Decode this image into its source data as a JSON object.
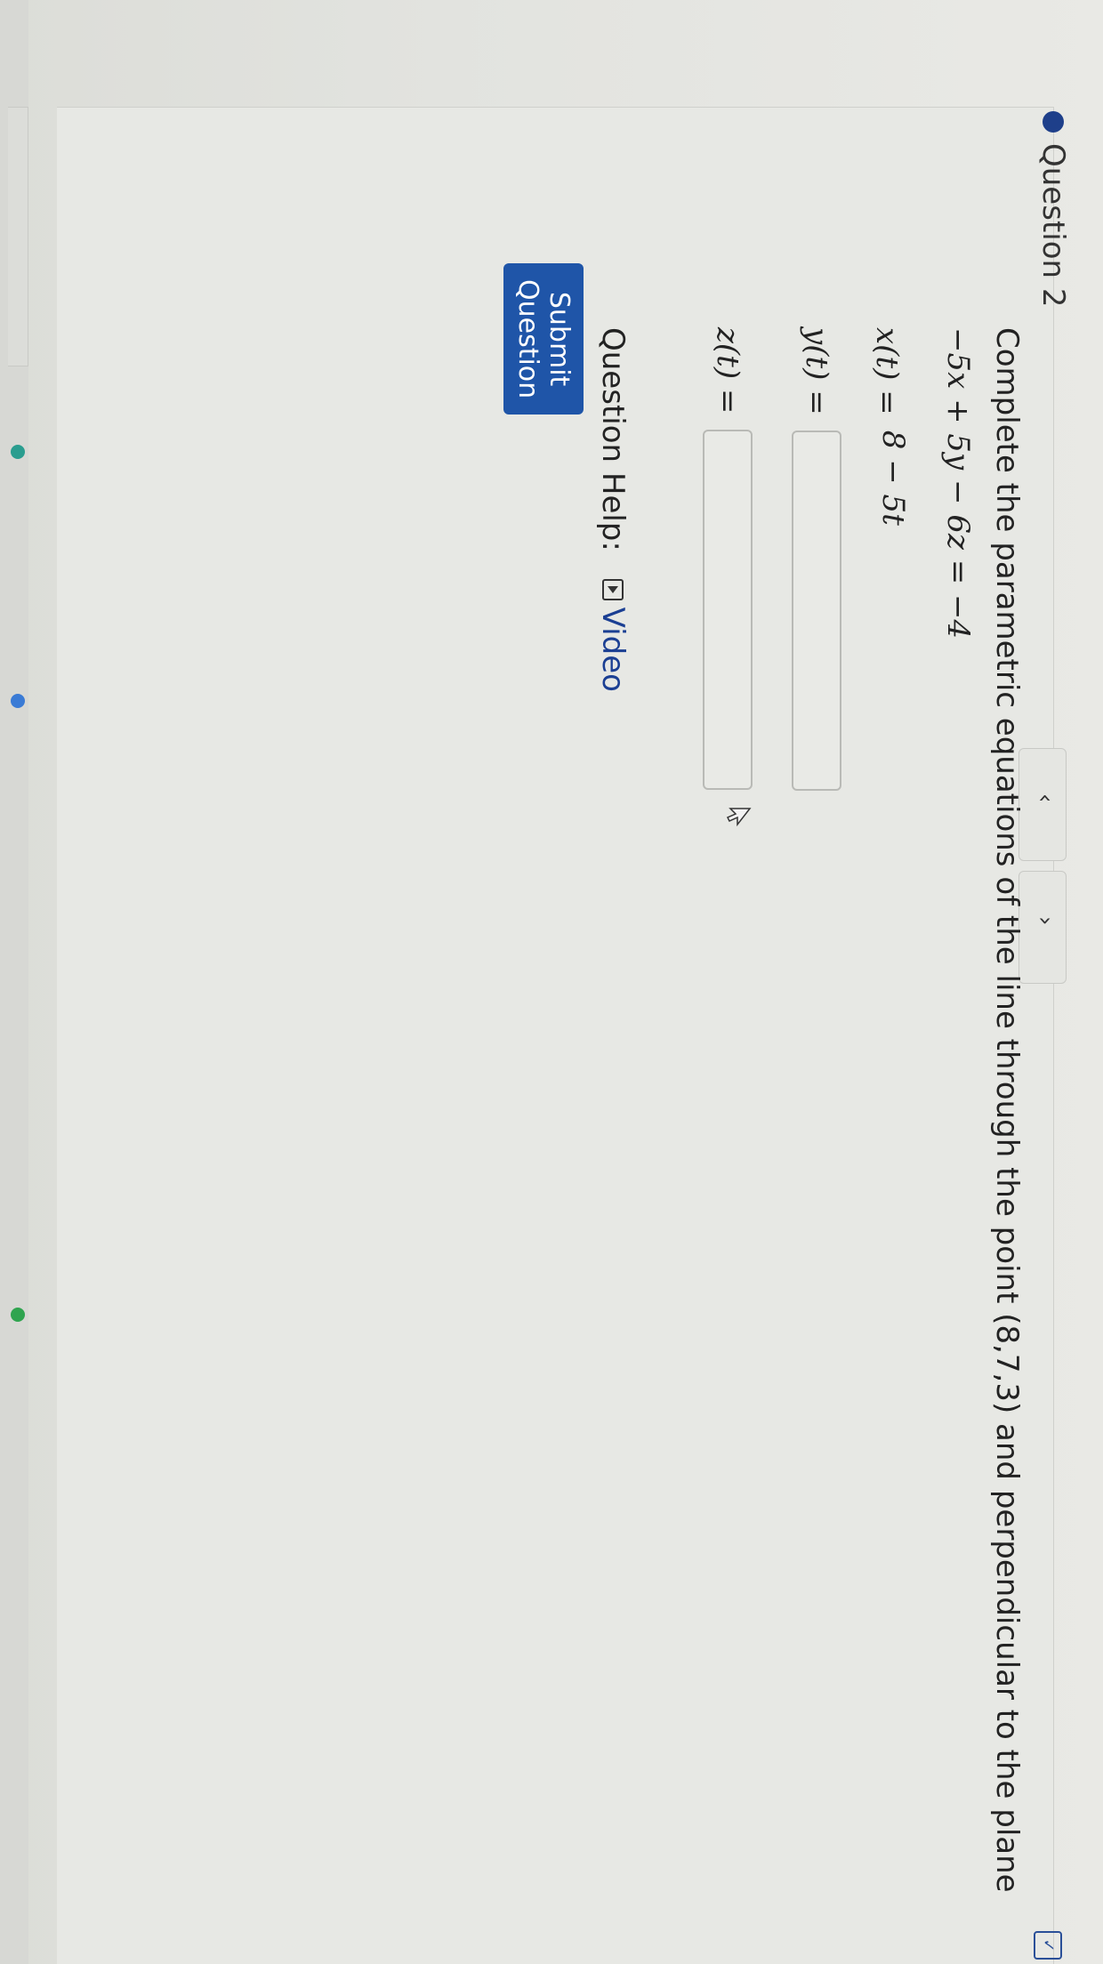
{
  "question": {
    "title": "Question 2",
    "prompt": "Complete the parametric equations of the line through the point (8,7,3) and perpendicular to the plane",
    "plane_equation": "−5x + 5y − 6z = −4"
  },
  "answers": [
    {
      "label": "x(t) =",
      "value": "8 − 5t"
    },
    {
      "label": "y(t) =",
      "value": ""
    },
    {
      "label": "z(t) =",
      "value": ""
    }
  ],
  "help": {
    "label": "Question Help:",
    "video_label": "Video"
  },
  "submit": {
    "label": "Submit Question"
  },
  "colors": {
    "accent": "#1f55a8",
    "title_bullet": "#1e3f8a"
  }
}
